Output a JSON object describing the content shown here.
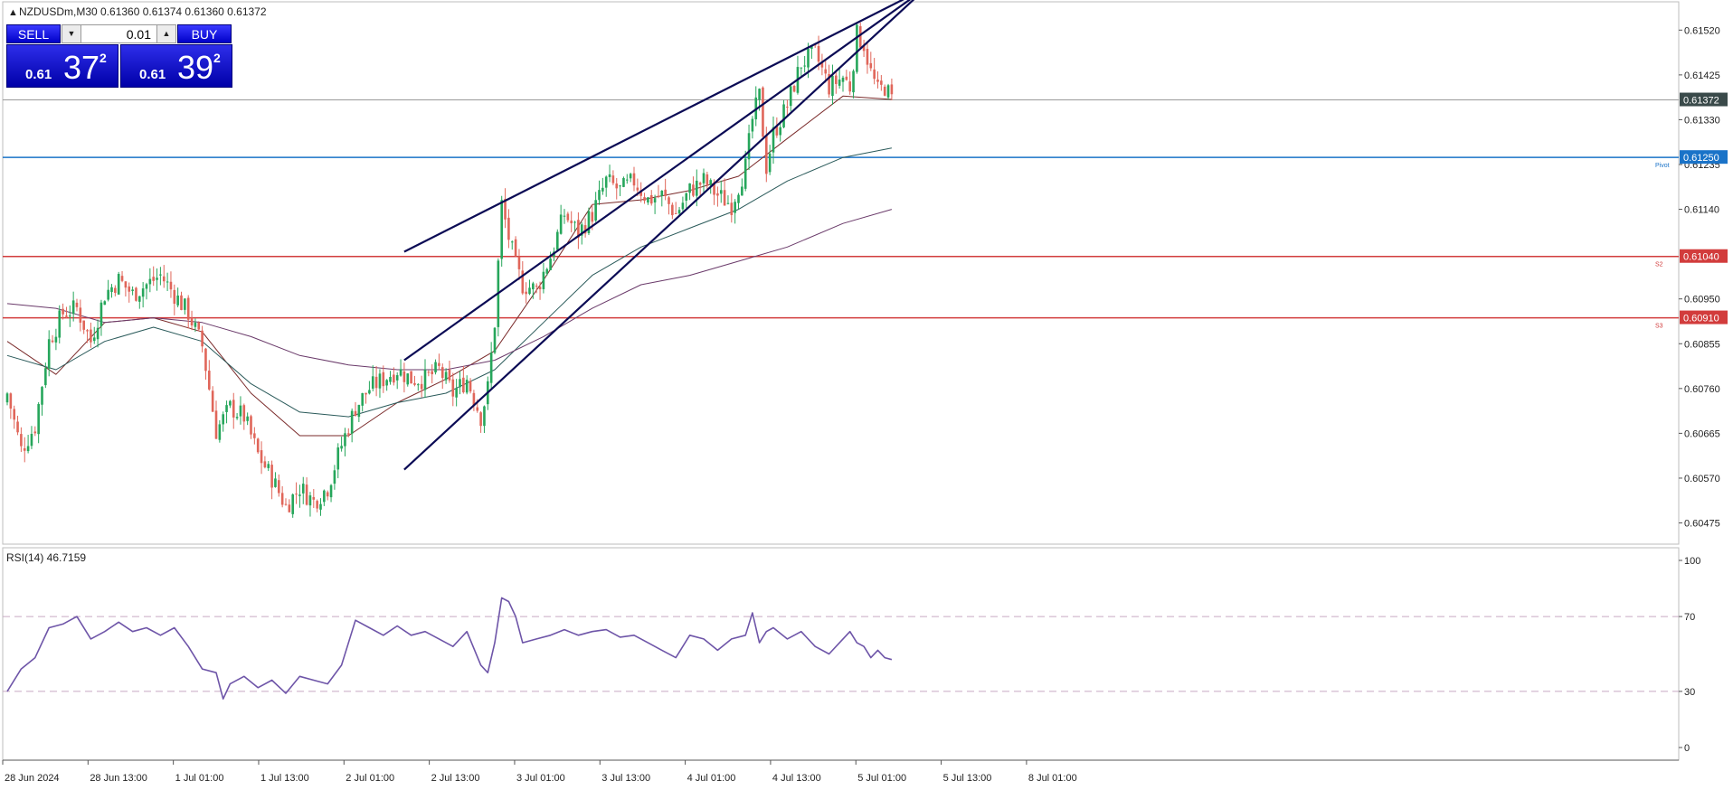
{
  "header": {
    "symbol_line": "NZDUSDm,M30  0.61360 0.61374 0.61360 0.61372",
    "menu_arrow_icon": "triangle-up-icon"
  },
  "trade_panel": {
    "sell_label": "SELL",
    "buy_label": "BUY",
    "lot_value": "0.01",
    "sell_price": {
      "small": "0.61",
      "big": "37",
      "sup": "2"
    },
    "buy_price": {
      "small": "0.61",
      "big": "39",
      "sup": "2"
    },
    "colors": {
      "button": "#1010e0"
    }
  },
  "chart_data": [
    {
      "type": "candlestick",
      "symbol": "NZDUSDm",
      "timeframe": "M30",
      "ylim": [
        0.6043,
        0.6158
      ],
      "y_ticks": [
        "0.61520",
        "0.61425",
        "0.61330",
        "0.61235",
        "0.61140",
        "0.60950",
        "0.60855",
        "0.60760",
        "0.60665",
        "0.60570",
        "0.60475"
      ],
      "x_ticks": [
        "28 Jun 2024",
        "28 Jun 13:00",
        "1 Jul 01:00",
        "1 Jul 13:00",
        "2 Jul 01:00",
        "2 Jul 13:00",
        "3 Jul 01:00",
        "3 Jul 13:00",
        "4 Jul 01:00",
        "4 Jul 13:00",
        "5 Jul 01:00",
        "5 Jul 13:00",
        "8 Jul 01:00"
      ],
      "close_path": [
        [
          0,
          0.6075
        ],
        [
          4,
          0.6063
        ],
        [
          8,
          0.6068
        ],
        [
          12,
          0.6086
        ],
        [
          16,
          0.6092
        ],
        [
          20,
          0.6093
        ],
        [
          24,
          0.6086
        ],
        [
          28,
          0.6096
        ],
        [
          32,
          0.6099
        ],
        [
          36,
          0.6096
        ],
        [
          40,
          0.6098
        ],
        [
          44,
          0.61
        ],
        [
          48,
          0.6096
        ],
        [
          52,
          0.6092
        ],
        [
          56,
          0.6085
        ],
        [
          60,
          0.6067
        ],
        [
          64,
          0.6072
        ],
        [
          68,
          0.607
        ],
        [
          72,
          0.6062
        ],
        [
          76,
          0.6057
        ],
        [
          80,
          0.6051
        ],
        [
          84,
          0.6055
        ],
        [
          88,
          0.6052
        ],
        [
          92,
          0.6055
        ],
        [
          96,
          0.6064
        ],
        [
          100,
          0.6072
        ],
        [
          104,
          0.6076
        ],
        [
          108,
          0.6078
        ],
        [
          112,
          0.608
        ],
        [
          116,
          0.6078
        ],
        [
          120,
          0.6078
        ],
        [
          124,
          0.608
        ],
        [
          128,
          0.6075
        ],
        [
          132,
          0.6078
        ],
        [
          136,
          0.607
        ],
        [
          138,
          0.6076
        ],
        [
          140,
          0.609
        ],
        [
          142,
          0.6115
        ],
        [
          144,
          0.6108
        ],
        [
          146,
          0.6102
        ],
        [
          148,
          0.6098
        ],
        [
          152,
          0.6097
        ],
        [
          156,
          0.6104
        ],
        [
          160,
          0.6113
        ],
        [
          164,
          0.6109
        ],
        [
          168,
          0.6113
        ],
        [
          172,
          0.612
        ],
        [
          176,
          0.6118
        ],
        [
          180,
          0.612
        ],
        [
          184,
          0.6116
        ],
        [
          188,
          0.6117
        ],
        [
          192,
          0.6113
        ],
        [
          196,
          0.6118
        ],
        [
          200,
          0.612
        ],
        [
          204,
          0.6117
        ],
        [
          208,
          0.6115
        ],
        [
          212,
          0.6123
        ],
        [
          214,
          0.6133
        ],
        [
          216,
          0.6138
        ],
        [
          218,
          0.6123
        ],
        [
          220,
          0.613
        ],
        [
          224,
          0.6136
        ],
        [
          228,
          0.6145
        ],
        [
          232,
          0.6147
        ],
        [
          236,
          0.614
        ],
        [
          240,
          0.6142
        ],
        [
          242,
          0.614
        ],
        [
          244,
          0.6151
        ],
        [
          246,
          0.6149
        ],
        [
          248,
          0.6143
        ],
        [
          250,
          0.6139
        ],
        [
          252,
          0.614
        ],
        [
          254,
          0.61372
        ]
      ],
      "series": [
        {
          "name": "NZDUSDm",
          "type": "candles",
          "up_color": "#26a65b",
          "down_color": "#e0665a"
        },
        {
          "type": "moving-average",
          "color": "#7a2a2a",
          "values": [
            0.6086,
            0.6079,
            0.609,
            0.6091,
            0.6088,
            0.6075,
            0.6066,
            0.6066,
            0.6073,
            0.6078,
            0.6084,
            0.6099,
            0.6115,
            0.6116,
            0.6118,
            0.6121,
            0.6129,
            0.6138,
            0.61373
          ]
        },
        {
          "type": "moving-average",
          "color": "#2a5a5a",
          "values": [
            0.6083,
            0.608,
            0.6086,
            0.6089,
            0.6086,
            0.6077,
            0.6071,
            0.607,
            0.6073,
            0.6075,
            0.608,
            0.609,
            0.61,
            0.6106,
            0.611,
            0.6114,
            0.612,
            0.6125,
            0.6127
          ]
        },
        {
          "type": "moving-average",
          "color": "#6a3a6a",
          "values": [
            0.6094,
            0.6093,
            0.609,
            0.6091,
            0.609,
            0.6087,
            0.6083,
            0.6081,
            0.608,
            0.608,
            0.6082,
            0.6087,
            0.6093,
            0.6098,
            0.61,
            0.6103,
            0.6106,
            0.6111,
            0.6114
          ]
        }
      ],
      "ma_x": [
        0,
        14,
        28,
        42,
        56,
        70,
        84,
        98,
        112,
        126,
        140,
        154,
        168,
        182,
        196,
        210,
        224,
        240,
        254
      ],
      "channel_lines": [
        {
          "from": [
            114,
            0.6105
          ],
          "to": [
            264,
            0.6161
          ]
        },
        {
          "from": [
            114,
            0.6082
          ],
          "to": [
            264,
            0.6161
          ]
        },
        {
          "from": [
            114,
            0.60588
          ],
          "to": [
            264,
            0.6161
          ]
        }
      ],
      "horizontal_levels": [
        {
          "value": 0.6125,
          "label": "0.61250",
          "tag": "Pivot",
          "color": "#1a73c8"
        },
        {
          "value": 0.6104,
          "label": "0.61040",
          "tag": "S2",
          "color": "#d23c3c"
        },
        {
          "value": 0.6091,
          "label": "0.60910",
          "tag": "S3",
          "color": "#d23c3c"
        }
      ],
      "current_price": {
        "value": 0.61372,
        "label": "0.61372",
        "color": "#3a4a4a"
      }
    },
    {
      "type": "line",
      "indicator": "RSI(14)",
      "title": "RSI(14) 46.7159",
      "ylim": [
        0,
        100
      ],
      "y_ticks": [
        "100",
        "70",
        "30",
        "0"
      ],
      "levels": [
        70,
        30
      ],
      "series": [
        {
          "color": "#6e55a8",
          "x": [
            0,
            4,
            8,
            12,
            16,
            20,
            24,
            28,
            32,
            36,
            40,
            44,
            48,
            52,
            56,
            60,
            62,
            64,
            68,
            72,
            76,
            80,
            84,
            88,
            92,
            96,
            100,
            104,
            108,
            112,
            116,
            120,
            124,
            128,
            132,
            136,
            138,
            140,
            142,
            144,
            146,
            148,
            152,
            156,
            160,
            164,
            168,
            172,
            176,
            180,
            184,
            188,
            192,
            196,
            200,
            204,
            208,
            212,
            214,
            216,
            218,
            220,
            224,
            228,
            232,
            236,
            240,
            242,
            244,
            246,
            248,
            250,
            252,
            254
          ],
          "values": [
            30,
            42,
            48,
            64,
            66,
            70,
            58,
            62,
            67,
            62,
            64,
            60,
            64,
            54,
            42,
            40,
            26,
            34,
            38,
            32,
            36,
            29,
            38,
            36,
            34,
            44,
            68,
            64,
            60,
            65,
            60,
            62,
            58,
            54,
            62,
            44,
            40,
            56,
            80,
            78,
            70,
            56,
            58,
            60,
            63,
            60,
            62,
            63,
            59,
            60,
            56,
            52,
            48,
            60,
            58,
            52,
            58,
            60,
            72,
            56,
            62,
            64,
            58,
            62,
            54,
            50,
            58,
            62,
            56,
            54,
            48,
            52,
            48,
            47
          ]
        }
      ]
    }
  ],
  "icons": {
    "dropdown": "triangle-down-icon",
    "spin_up": "triangle-up-icon"
  }
}
